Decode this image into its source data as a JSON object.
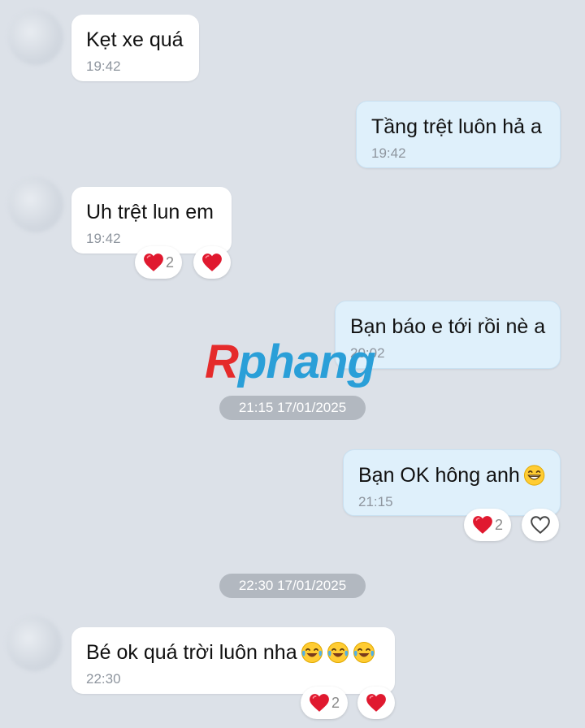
{
  "colors": {
    "background": "#dce1e8",
    "incoming_bubble": "#ffffff",
    "outgoing_bubble": "#dff0fb",
    "heart": "#e0192f",
    "date_chip": "#b2b8c0",
    "watermark_r": "#e52b2b",
    "watermark_text": "#2a9fd8"
  },
  "messages": [
    {
      "text": "Kẹt xe quá",
      "time": "19:42"
    },
    {
      "text": "Tầng trệt luôn hả a",
      "time": "19:42"
    },
    {
      "text": "Uh trệt lun em",
      "time": "19:42",
      "reaction_count": "2"
    },
    {
      "text": "Bạn báo e tới rồi nè a",
      "time": "20:02"
    },
    {
      "text": "Bạn OK hông anh",
      "time": "21:15",
      "reaction_count": "2"
    },
    {
      "text": "Bé ok quá trời luôn nha",
      "time": "22:30",
      "reaction_count": "2"
    }
  ],
  "date_separators": [
    "21:15 17/01/2025",
    "22:30 17/01/2025"
  ],
  "watermark": {
    "first": "R",
    "rest": "phang"
  },
  "icons": [
    "heart-icon",
    "heart-outline-icon",
    "grinning-sweat-emoji-icon",
    "tears-of-joy-emoji-icon"
  ]
}
